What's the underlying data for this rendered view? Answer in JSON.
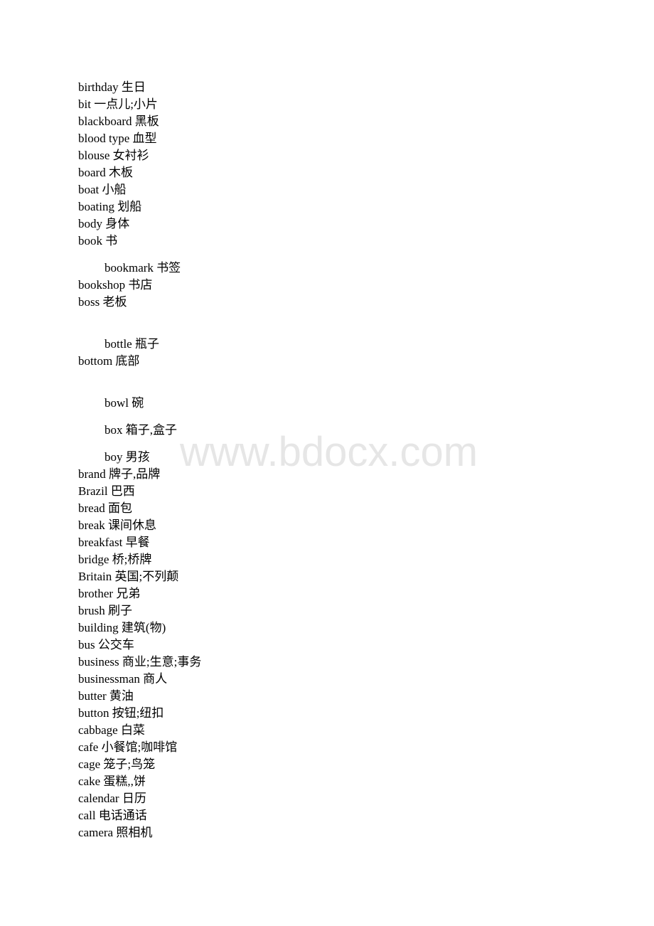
{
  "entries": [
    {
      "word": "birthday",
      "meaning": "生日"
    },
    {
      "word": "bit",
      "meaning": "一点儿;小片"
    },
    {
      "word": "blackboard",
      "meaning": "黑板"
    },
    {
      "word": "blood type",
      "meaning": "血型"
    },
    {
      "word": "blouse",
      "meaning": "女衬衫"
    },
    {
      "word": "board",
      "meaning": "木板"
    },
    {
      "word": "boat",
      "meaning": "小船"
    },
    {
      "word": "boating",
      "meaning": "划船"
    },
    {
      "word": "body",
      "meaning": "身体"
    },
    {
      "word": "book",
      "meaning": "书"
    },
    {
      "word": "bookmark",
      "meaning": "书签"
    },
    {
      "word": "bookshop",
      "meaning": "书店"
    },
    {
      "word": "boss",
      "meaning": "老板"
    },
    {
      "word": "bottle",
      "meaning": "瓶子"
    },
    {
      "word": "bottom",
      "meaning": "底部"
    },
    {
      "word": "bowl",
      "meaning": "碗"
    },
    {
      "word": "box",
      "meaning": "箱子,盒子"
    },
    {
      "word": "boy",
      "meaning": "男孩"
    },
    {
      "word": "brand",
      "meaning": "牌子,品牌"
    },
    {
      "word": "Brazil",
      "meaning": "巴西"
    },
    {
      "word": "bread",
      "meaning": "面包"
    },
    {
      "word": "break",
      "meaning": "课间休息"
    },
    {
      "word": "breakfast",
      "meaning": "早餐"
    },
    {
      "word": "bridge",
      "meaning": "桥;桥牌"
    },
    {
      "word": "Britain",
      "meaning": "英国;不列颠"
    },
    {
      "word": "brother",
      "meaning": "兄弟"
    },
    {
      "word": "brush",
      "meaning": "刷子"
    },
    {
      "word": "building",
      "meaning": "建筑(物)"
    },
    {
      "word": "bus",
      "meaning": "公交车"
    },
    {
      "word": "business",
      "meaning": "商业;生意;事务"
    },
    {
      "word": "businessman",
      "meaning": "商人"
    },
    {
      "word": "butter",
      "meaning": "黄油"
    },
    {
      "word": "button",
      "meaning": "按钮;纽扣"
    },
    {
      "word": "cabbage",
      "meaning": "白菜"
    },
    {
      "word": "cafe",
      "meaning": "小餐馆;咖啡馆"
    },
    {
      "word": "cage",
      "meaning": "笼子;鸟笼"
    },
    {
      "word": "cake",
      "meaning": "蛋糕,,饼"
    },
    {
      "word": "calendar",
      "meaning": "日历"
    },
    {
      "word": "call",
      "meaning": "电话通话"
    },
    {
      "word": "camera",
      "meaning": "照相机"
    }
  ],
  "watermark": "www.bdocx.com"
}
